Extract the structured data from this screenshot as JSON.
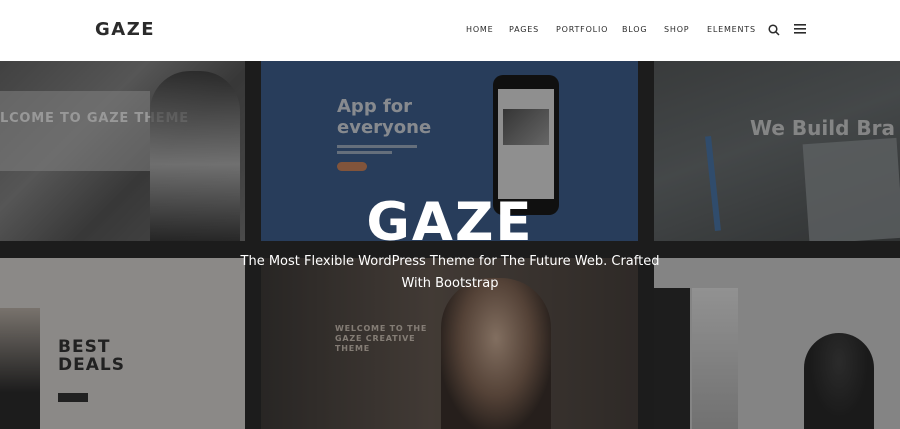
{
  "header": {
    "logo": "GAZE",
    "nav": [
      {
        "label": "HOME"
      },
      {
        "label": "PAGES"
      },
      {
        "label": "PORTFOLIO"
      },
      {
        "label": "BLOG"
      },
      {
        "label": "SHOP"
      },
      {
        "label": "ELEMENTS"
      }
    ],
    "icons": {
      "search": "search-icon",
      "menu": "hamburger-menu-icon"
    }
  },
  "hero": {
    "title": "GAZE",
    "subtitle": "The Most Flexible WordPress Theme for The Future Web. Crafted With Bootstrap",
    "tiles": {
      "welcome_banner": "LCOME TO GAZE THEME",
      "app_title": "App for everyone",
      "build_text": "We Build Bra",
      "best_deals": "BEST DEALS",
      "creative_welcome": "WELCOME TO THE GAZE CREATIVE THEME"
    }
  },
  "colors": {
    "header_bg": "#ffffff",
    "text_dark": "#2b2b2b",
    "app_tile_blue": "#3e6396",
    "accent_orange": "#e98f5a"
  }
}
